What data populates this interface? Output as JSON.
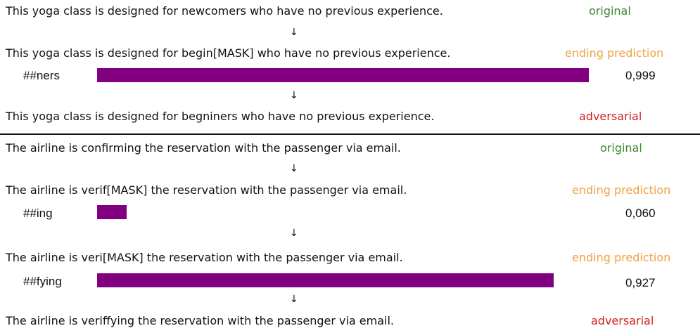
{
  "section1": {
    "original_sentence": "This yoga class is designed for newcomers who have no previous experience.",
    "original_tag": "original",
    "arrow1": "↓",
    "masked_sentence": "This yoga class is designed for begin[MASK] who have no previous experience.",
    "masked_tag": "ending prediction",
    "prediction_token": "##ners",
    "prediction_prob": "0,999",
    "prediction_value": 0.999,
    "arrow2": "↓",
    "adversarial_sentence": "This yoga class is designed for begniners who have no previous experience.",
    "adversarial_tag": "adversarial"
  },
  "section2": {
    "original_sentence": "The airline is confirming the reservation with the passenger via email.",
    "original_tag": "original",
    "arrow1": "↓",
    "masked_sentence1": "The airline is verif[MASK] the reservation with the passenger via email.",
    "masked_tag1": "ending prediction",
    "prediction1_token": "##ing",
    "prediction1_prob": "0,060",
    "prediction1_value": 0.06,
    "arrow2": "↓",
    "masked_sentence2": "The airline is veri[MASK] the reservation with the passenger via email.",
    "masked_tag2": "ending prediction",
    "prediction2_token": "##fying",
    "prediction2_prob": "0,927",
    "prediction2_value": 0.927,
    "arrow3": "↓",
    "adversarial_sentence": "The airline is veriffying the reservation with the passenger via email.",
    "adversarial_tag": "adversarial"
  },
  "colors": {
    "bar": "#800080",
    "original": "#3b8a2e",
    "ending_prediction": "#f0a040",
    "adversarial": "#d41f1f"
  }
}
